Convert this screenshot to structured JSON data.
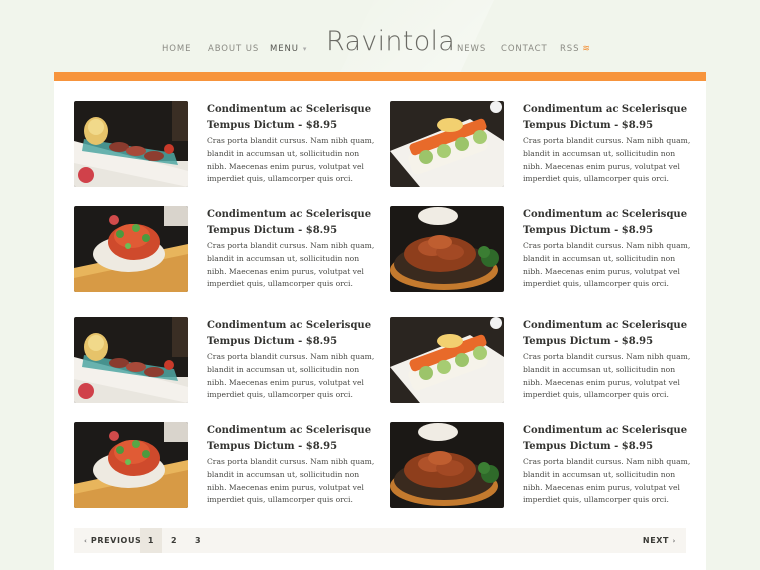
{
  "header": {
    "logo": "Ravintola",
    "nav_left": [
      "HOME",
      "ABOUT US",
      "MENU"
    ],
    "nav_right": [
      "NEWS",
      "CONTACT",
      "RSS"
    ]
  },
  "colors": {
    "accent": "#f7943c",
    "background": "#f1f5ec"
  },
  "menu_items": [
    {
      "title": "Condimentum ac Scelerisque Tempus Dictum - $8.95",
      "description": "Cras porta blandit cursus. Nam nibh quam, blandit in accumsan ut, sollicitudin non nibh. Maecenas enim purus, volutpat vel imperdiet quis, ullamcorper quis orci.",
      "image": "sashimi-plate"
    },
    {
      "title": "Condimentum ac Scelerisque Tempus Dictum - $8.95",
      "description": "Cras porta blandit cursus. Nam nibh quam, blandit in accumsan ut, sollicitudin non nibh. Maecenas enim purus, volutpat vel imperdiet quis, ullamcorper quis orci.",
      "image": "sushi-roll"
    },
    {
      "title": "Condimentum ac Scelerisque Tempus Dictum - $8.95",
      "description": "Cras porta blandit cursus. Nam nibh quam, blandit in accumsan ut, sollicitudin non nibh. Maecenas enim purus, volutpat vel imperdiet quis, ullamcorper quis orci.",
      "image": "tuna-salad"
    },
    {
      "title": "Condimentum ac Scelerisque Tempus Dictum - $8.95",
      "description": "Cras porta blandit cursus. Nam nibh quam, blandit in accumsan ut, sollicitudin non nibh. Maecenas enim purus, volutpat vel imperdiet quis, ullamcorper quis orci.",
      "image": "teriyaki-chicken"
    },
    {
      "title": "Condimentum ac Scelerisque Tempus Dictum - $8.95",
      "description": "Cras porta blandit cursus. Nam nibh quam, blandit in accumsan ut, sollicitudin non nibh. Maecenas enim purus, volutpat vel imperdiet quis, ullamcorper quis orci.",
      "image": "sashimi-plate"
    },
    {
      "title": "Condimentum ac Scelerisque Tempus Dictum - $8.95",
      "description": "Cras porta blandit cursus. Nam nibh quam, blandit in accumsan ut, sollicitudin non nibh. Maecenas enim purus, volutpat vel imperdiet quis, ullamcorper quis orci.",
      "image": "sushi-roll"
    },
    {
      "title": "Condimentum ac Scelerisque Tempus Dictum - $8.95",
      "description": "Cras porta blandit cursus. Nam nibh quam, blandit in accumsan ut, sollicitudin non nibh. Maecenas enim purus, volutpat vel imperdiet quis, ullamcorper quis orci.",
      "image": "tuna-salad"
    },
    {
      "title": "Condimentum ac Scelerisque Tempus Dictum - $8.95",
      "description": "Cras porta blandit cursus. Nam nibh quam, blandit in accumsan ut, sollicitudin non nibh. Maecenas enim purus, volutpat vel imperdiet quis, ullamcorper quis orci.",
      "image": "teriyaki-chicken"
    }
  ],
  "pagination": {
    "previous": "PREVIOUS",
    "pages": [
      "1",
      "2",
      "3"
    ],
    "current": "1",
    "next": "NEXT"
  }
}
